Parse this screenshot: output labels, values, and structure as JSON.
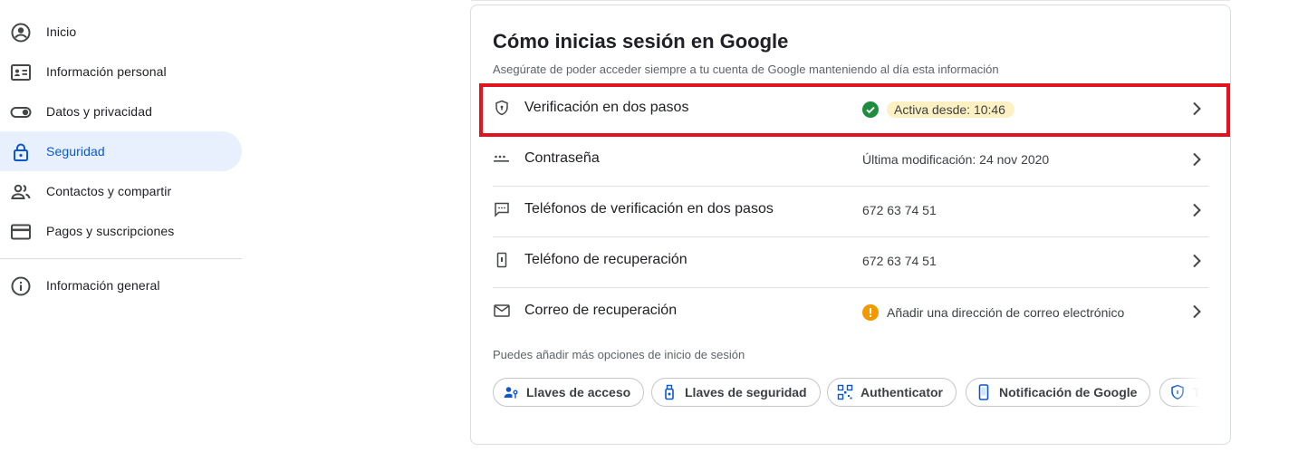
{
  "sidebar": {
    "items": [
      {
        "label": "Inicio",
        "icon": "account-circle-icon"
      },
      {
        "label": "Información personal",
        "icon": "id-card-icon"
      },
      {
        "label": "Datos y privacidad",
        "icon": "toggle-icon"
      },
      {
        "label": "Seguridad",
        "icon": "lock-icon",
        "active": true
      },
      {
        "label": "Contactos y compartir",
        "icon": "people-icon"
      },
      {
        "label": "Pagos y suscripciones",
        "icon": "credit-card-icon"
      }
    ],
    "footer_item": {
      "label": "Información general",
      "icon": "info-icon"
    }
  },
  "card": {
    "title": "Cómo inicias sesión en Google",
    "subtitle": "Asegúrate de poder acceder siempre a tu cuenta de Google manteniendo al día esta información",
    "rows": [
      {
        "label": "Verificación en dos pasos",
        "value": "Activa desde: 10:46",
        "icon": "shield-icon",
        "status": "ok",
        "highlighted": true
      },
      {
        "label": "Contraseña",
        "value": "Última modificación: 24 nov 2020",
        "icon": "password-dots-icon"
      },
      {
        "label": "Teléfonos de verificación en dos pasos",
        "value": "672 63 74 51",
        "icon": "message-icon"
      },
      {
        "label": "Teléfono de recuperación",
        "value": "672 63 74 51",
        "icon": "phone-icon"
      },
      {
        "label": "Correo de recuperación",
        "value": "Añadir una dirección de correo electrónico",
        "icon": "mail-icon",
        "status": "warning"
      }
    ],
    "more_options_text": "Puedes añadir más opciones de inicio de sesión",
    "chips": [
      {
        "label": "Llaves de acceso",
        "icon": "passkey-icon"
      },
      {
        "label": "Llaves de seguridad",
        "icon": "security-key-icon"
      },
      {
        "label": "Authenticator",
        "icon": "qr-code-icon"
      },
      {
        "label": "Notificación de Google",
        "icon": "smartphone-icon"
      },
      {
        "label": "T",
        "icon": "shield-icon"
      }
    ]
  },
  "colors": {
    "accent": "#0b57d0",
    "active_nav_bg": "#e8f0fe",
    "success": "#1e8e3e",
    "warning": "#f29900",
    "highlight": "#fdf1c4",
    "annotation_box": "#e1131e"
  }
}
